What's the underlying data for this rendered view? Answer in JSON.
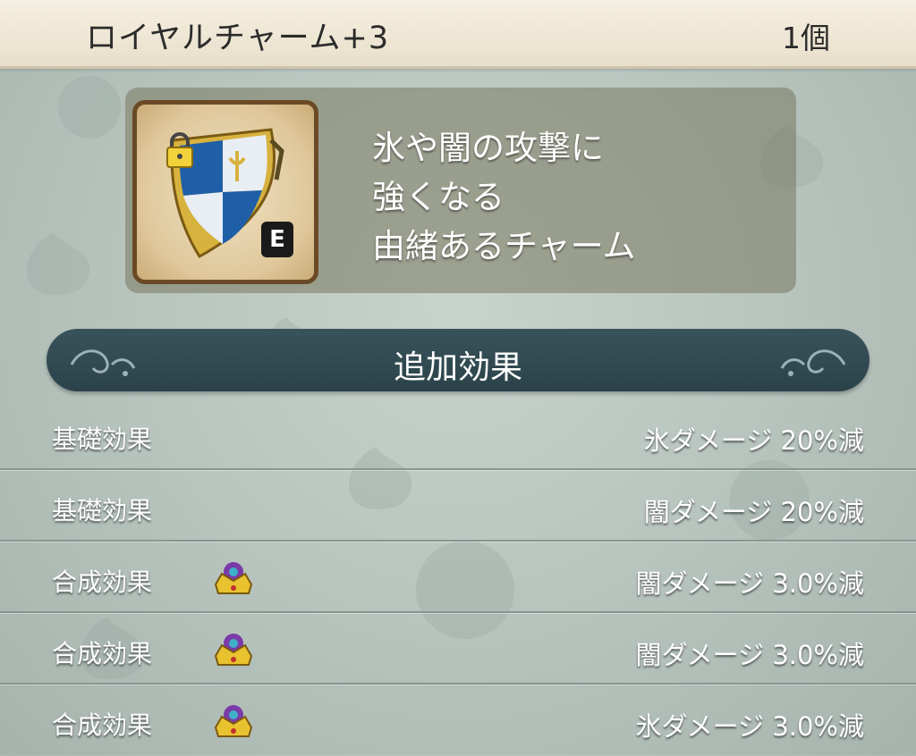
{
  "header": {
    "title": "ロイヤルチャーム+3",
    "count": "1個"
  },
  "item": {
    "icon": "royal-charm-shield-icon",
    "lock_icon": "padlock-icon",
    "equipped_badge": "E",
    "description": [
      "氷や闇の攻撃に",
      "強くなる",
      "由緒あるチャーム"
    ]
  },
  "section": {
    "title": "追加効果"
  },
  "effects": [
    {
      "kind": "基礎効果",
      "value": "氷ダメージ 20%減",
      "crown": false
    },
    {
      "kind": "基礎効果",
      "value": "闇ダメージ 20%減",
      "crown": false
    },
    {
      "kind": "合成効果",
      "value": "闇ダメージ 3.0%減",
      "crown": true
    },
    {
      "kind": "合成効果",
      "value": "闇ダメージ 3.0%減",
      "crown": true
    },
    {
      "kind": "合成効果",
      "value": "氷ダメージ 3.0%減",
      "crown": true
    }
  ],
  "colors": {
    "panel_bar": "#2f474e",
    "frame": "#6a4a26",
    "shield_blue": "#1f5fa8",
    "gold": "#d7b23e"
  }
}
